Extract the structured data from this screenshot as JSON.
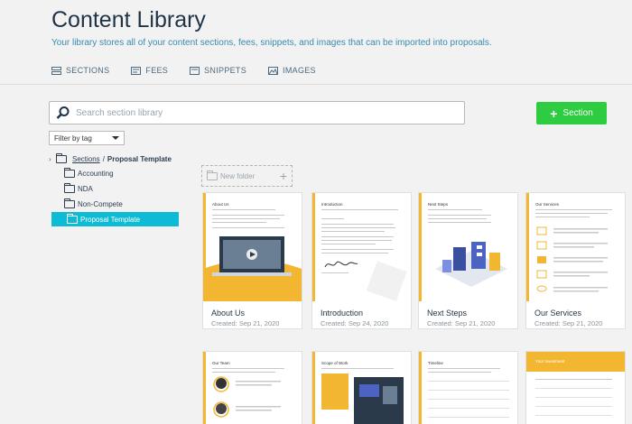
{
  "page": {
    "title": "Content Library",
    "subtitle": "Your library stores all of your content sections, fees, snippets, and images that can be imported into proposals."
  },
  "tabs": [
    {
      "label": "SECTIONS",
      "icon": "sections-icon",
      "active": true
    },
    {
      "label": "FEES",
      "icon": "fees-icon",
      "active": false
    },
    {
      "label": "SNIPPETS",
      "icon": "snippets-icon",
      "active": false
    },
    {
      "label": "IMAGES",
      "icon": "images-icon",
      "active": false
    }
  ],
  "search": {
    "placeholder": "Search section library"
  },
  "add_button": {
    "label": "Section"
  },
  "filter": {
    "label": "Filter by tag"
  },
  "tree": {
    "root_label": "Sections",
    "separator": "/",
    "current": "Proposal Template",
    "folders": [
      "Accounting",
      "NDA",
      "Non-Compete",
      "Proposal Template"
    ],
    "selected": "Proposal Template"
  },
  "new_folder": {
    "label": "New folder"
  },
  "cards": [
    {
      "name": "About Us",
      "created": "Created: Sep 21, 2020",
      "thumb_title": "About Us"
    },
    {
      "name": "Introduction",
      "created": "Created: Sep 24, 2020",
      "thumb_title": "Introduction"
    },
    {
      "name": "Next Steps",
      "created": "Created: Sep 21, 2020",
      "thumb_title": "Next Steps"
    },
    {
      "name": "Our Services",
      "created": "Created: Sep 21, 2020",
      "thumb_title": "Our Services"
    }
  ],
  "cards_row2": [
    {
      "thumb_title": "Our Team"
    },
    {
      "thumb_title": "Scope of Work"
    },
    {
      "thumb_title": "Timeline"
    },
    {
      "thumb_title": "Your Investment"
    }
  ],
  "colors": {
    "accent": "#2ecc40",
    "selected": "#0dbcd4",
    "stripe": "#f2b630",
    "title": "#1f3347",
    "subtitle": "#3a8bb0"
  }
}
